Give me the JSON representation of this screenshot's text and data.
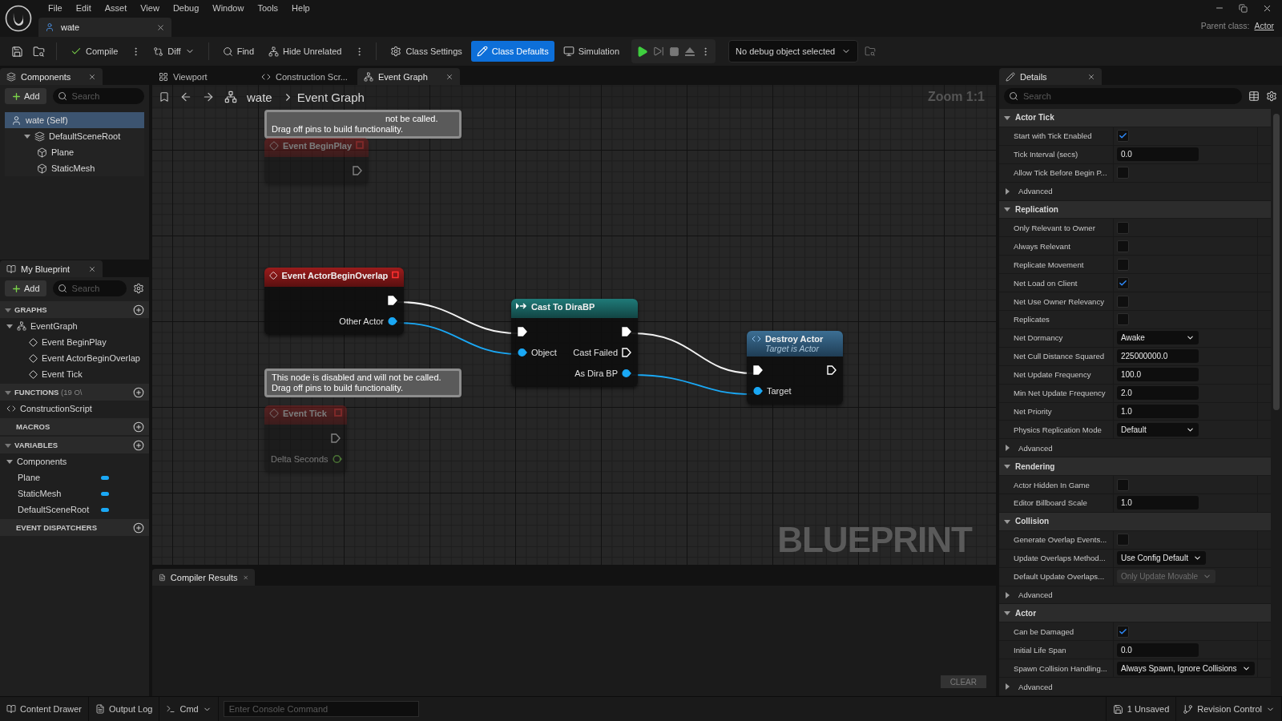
{
  "menu": [
    "File",
    "Edit",
    "Asset",
    "View",
    "Debug",
    "Window",
    "Tools",
    "Help"
  ],
  "document_tab": {
    "title": "wate"
  },
  "parent_class": {
    "label": "Parent class:",
    "value": "Actor"
  },
  "toolbar": [
    {
      "label": "Compile",
      "selected": false,
      "more": true
    },
    {
      "label": "Diff",
      "selected": false,
      "dropdown": true
    },
    {
      "label": "Find",
      "selected": false
    },
    {
      "label": "Hide Unrelated",
      "selected": false,
      "more": true
    },
    {
      "label": "Class Settings",
      "selected": false
    },
    {
      "label": "Class Defaults",
      "selected": true
    },
    {
      "label": "Simulation",
      "selected": false
    }
  ],
  "debug_object": {
    "value": "No debug object selected"
  },
  "components_panel": {
    "title": "Components",
    "add": "Add",
    "search_placeholder": "Search",
    "tree": [
      {
        "label": "wate (Self)",
        "kind": "actor",
        "selected": true,
        "children": [
          {
            "label": "DefaultSceneRoot",
            "kind": "scene",
            "selected": false,
            "expanded": true,
            "children": [
              {
                "label": "Plane",
                "kind": "mesh",
                "selected": false
              },
              {
                "label": "StaticMesh",
                "kind": "mesh",
                "selected": false
              }
            ]
          }
        ]
      }
    ]
  },
  "my_blueprint": {
    "title": "My Blueprint",
    "add": "Add",
    "search_placeholder": "Search",
    "sections": [
      {
        "title": "GRAPHS",
        "expanded": true,
        "items": [
          {
            "label": "EventGraph",
            "kind": "graph",
            "expanded": true,
            "children": [
              {
                "label": "Event BeginPlay",
                "kind": "event"
              },
              {
                "label": "Event ActorBeginOverlap",
                "kind": "event"
              },
              {
                "label": "Event Tick",
                "kind": "event"
              }
            ]
          }
        ]
      },
      {
        "title": "FUNCTIONS",
        "count": "(19 O\\",
        "expanded": true,
        "items": [
          {
            "label": "ConstructionScript",
            "kind": "function"
          }
        ]
      },
      {
        "title": "MACROS"
      },
      {
        "title": "VARIABLES",
        "expanded": true,
        "items": [
          {
            "label": "Components",
            "kind": "category",
            "expanded": true,
            "children": [
              {
                "label": "Plane",
                "kind": "variable",
                "color": "#1aa8f5"
              },
              {
                "label": "StaticMesh",
                "kind": "variable",
                "color": "#1aa8f5"
              },
              {
                "label": "DefaultSceneRoot",
                "kind": "variable",
                "color": "#1aa8f5"
              }
            ]
          }
        ]
      },
      {
        "title": "EVENT DISPATCHERS"
      }
    ]
  },
  "editor_tabs": [
    {
      "label": "Viewport",
      "kind": "viewport",
      "selected": false
    },
    {
      "label": "Construction Scr...",
      "kind": "function",
      "selected": false
    },
    {
      "label": "Event Graph",
      "kind": "graph",
      "selected": true
    }
  ],
  "graph": {
    "breadcrumb": [
      "wate",
      "Event Graph"
    ],
    "zoom": "Zoom 1:1",
    "watermark": "BLUEPRINT",
    "comments": [
      {
        "lines": [
          "not be called.",
          "Drag off pins to build functionality."
        ]
      },
      {
        "lines": [
          "This node is disabled and will not be called.",
          "Drag off pins to build functionality."
        ]
      }
    ],
    "nodes": [
      {
        "kind": "event",
        "title": "Event BeginPlay",
        "disabled": true,
        "rows": [
          {
            "right": {
              "kind": "exec",
              "connected": false
            }
          }
        ]
      },
      {
        "kind": "event",
        "title": "Event ActorBeginOverlap",
        "disabled": false,
        "rows": [
          {
            "right": {
              "kind": "exec",
              "connected": true
            }
          },
          {
            "right": {
              "kind": "object",
              "label": "Other Actor",
              "connected": true
            }
          }
        ]
      },
      {
        "kind": "cast",
        "title": "Cast To DiraBP",
        "disabled": false,
        "rows": [
          {
            "left": {
              "kind": "exec",
              "connected": true
            },
            "right": {
              "kind": "exec",
              "connected": true
            }
          },
          {
            "left": {
              "kind": "object",
              "label": "Object",
              "connected": true
            },
            "right": {
              "kind": "exec",
              "label": "Cast Failed",
              "connected": false
            }
          },
          {
            "right": {
              "kind": "object",
              "label": "As Dira BP",
              "connected": true
            }
          }
        ]
      },
      {
        "kind": "function",
        "title": "Destroy Actor",
        "subtitle": "Target is Actor",
        "disabled": false,
        "rows": [
          {
            "left": {
              "kind": "exec",
              "connected": true
            },
            "right": {
              "kind": "exec",
              "connected": false
            }
          },
          {
            "left": {
              "kind": "object",
              "label": "Target",
              "connected": true
            }
          }
        ]
      },
      {
        "kind": "event",
        "title": "Event Tick",
        "disabled": true,
        "rows": [
          {
            "right": {
              "kind": "exec",
              "connected": false
            }
          },
          {
            "right": {
              "kind": "float",
              "label": "Delta Seconds",
              "connected": false
            }
          }
        ]
      }
    ]
  },
  "compiler_results": {
    "title": "Compiler Results",
    "clear": "CLEAR"
  },
  "details": {
    "title": "Details",
    "search_placeholder": "Search",
    "sections": [
      {
        "title": "Actor Tick",
        "expanded": true,
        "rows": [
          {
            "kind": "checkbox",
            "label": "Start with Tick Enabled",
            "checked": true
          },
          {
            "kind": "number",
            "label": "Tick Interval (secs)",
            "value": "0.0"
          },
          {
            "kind": "checkbox",
            "label": "Allow Tick Before Begin P...",
            "checked": false
          },
          {
            "kind": "advanced",
            "label": "Advanced",
            "expanded": false
          }
        ]
      },
      {
        "title": "Replication",
        "expanded": true,
        "rows": [
          {
            "kind": "checkbox",
            "label": "Only Relevant to Owner",
            "checked": false
          },
          {
            "kind": "checkbox",
            "label": "Always Relevant",
            "checked": false
          },
          {
            "kind": "checkbox",
            "label": "Replicate Movement",
            "checked": false
          },
          {
            "kind": "checkbox",
            "label": "Net Load on Client",
            "checked": true
          },
          {
            "kind": "checkbox",
            "label": "Net Use Owner Relevancy",
            "checked": false
          },
          {
            "kind": "checkbox",
            "label": "Replicates",
            "checked": false
          },
          {
            "kind": "select",
            "label": "Net Dormancy",
            "value": "Awake",
            "disabled": false
          },
          {
            "kind": "number",
            "label": "Net Cull Distance Squared",
            "value": "225000000.0"
          },
          {
            "kind": "number",
            "label": "Net Update Frequency",
            "value": "100.0"
          },
          {
            "kind": "number",
            "label": "Min Net Update Frequency",
            "value": "2.0"
          },
          {
            "kind": "number",
            "label": "Net Priority",
            "value": "1.0"
          },
          {
            "kind": "select",
            "label": "Physics Replication Mode",
            "value": "Default",
            "disabled": false
          },
          {
            "kind": "advanced",
            "label": "Advanced",
            "expanded": false
          }
        ]
      },
      {
        "title": "Rendering",
        "expanded": true,
        "rows": [
          {
            "kind": "checkbox",
            "label": "Actor Hidden In Game",
            "checked": false
          },
          {
            "kind": "number",
            "label": "Editor Billboard Scale",
            "value": "1.0"
          }
        ]
      },
      {
        "title": "Collision",
        "expanded": true,
        "rows": [
          {
            "kind": "checkbox",
            "label": "Generate Overlap Events...",
            "checked": false
          },
          {
            "kind": "select",
            "label": "Update Overlaps Method...",
            "value": "Use Config Default",
            "disabled": false
          },
          {
            "kind": "select",
            "label": "Default Update Overlaps...",
            "value": "Only Update Movable",
            "disabled": true
          },
          {
            "kind": "advanced",
            "label": "Advanced",
            "expanded": false
          }
        ]
      },
      {
        "title": "Actor",
        "expanded": true,
        "rows": [
          {
            "kind": "checkbox",
            "label": "Can be Damaged",
            "checked": true
          },
          {
            "kind": "number",
            "label": "Initial Life Span",
            "value": "0.0"
          },
          {
            "kind": "select",
            "label": "Spawn Collision Handling...",
            "value": "Always Spawn, Ignore Collisions",
            "disabled": false
          },
          {
            "kind": "advanced",
            "label": "Advanced",
            "expanded": false
          }
        ]
      }
    ]
  },
  "status_bar": {
    "items": [
      {
        "label": "Content Drawer",
        "kind": "drawer"
      },
      {
        "label": "Output Log",
        "kind": "log"
      },
      {
        "label": "Cmd",
        "kind": "cmd"
      }
    ],
    "console_placeholder": "Enter Console Command",
    "unsaved": "1 Unsaved",
    "revision_control": "Revision Control"
  }
}
